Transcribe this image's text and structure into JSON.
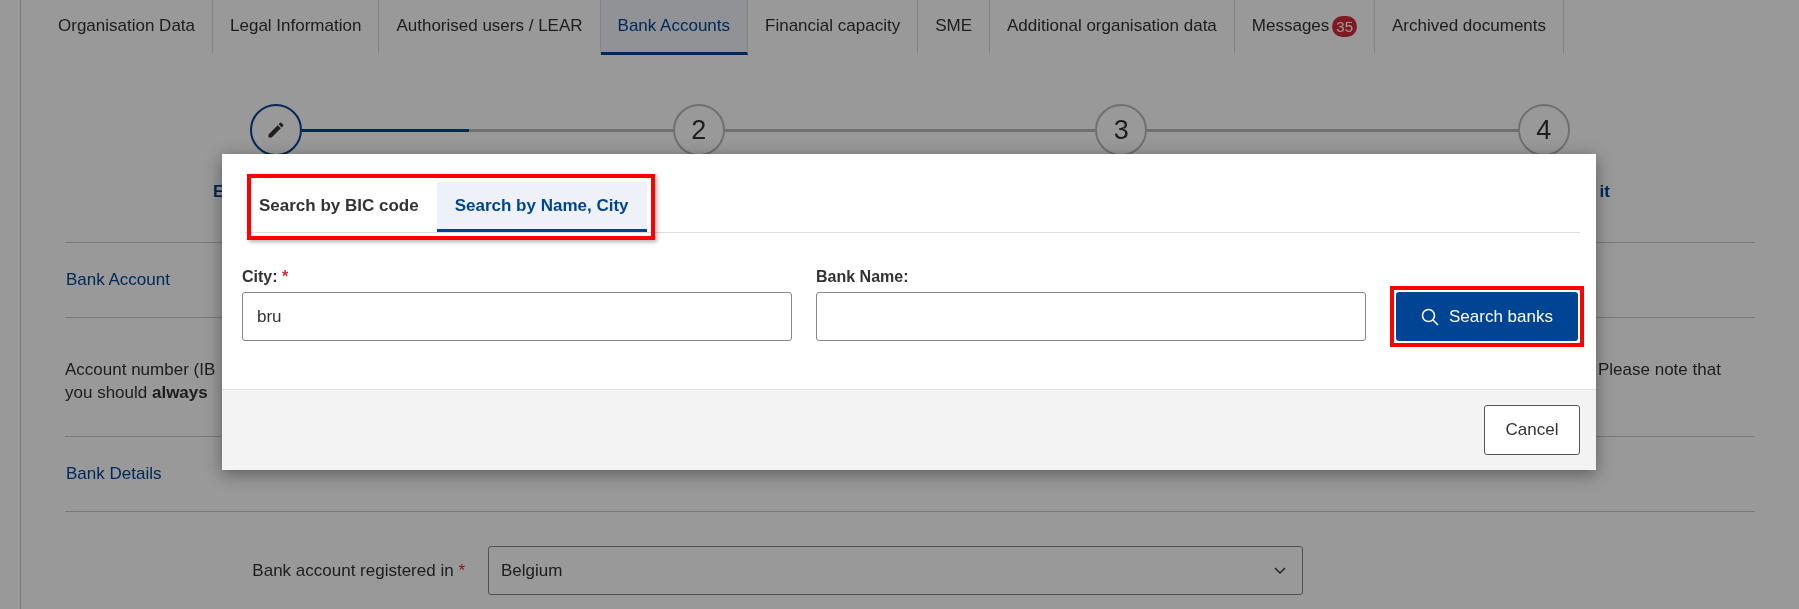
{
  "tabs": [
    {
      "label": "Organisation Data",
      "selected": false
    },
    {
      "label": "Legal Information",
      "selected": false
    },
    {
      "label": "Authorised users / LEAR",
      "selected": false
    },
    {
      "label": "Bank Accounts",
      "selected": true
    },
    {
      "label": "Financial capacity",
      "selected": false
    },
    {
      "label": "SME",
      "selected": false
    },
    {
      "label": "Additional organisation data",
      "selected": false
    },
    {
      "label": "Messages",
      "badge": "35",
      "selected": false
    },
    {
      "label": "Archived documents",
      "selected": false
    }
  ],
  "stepper": [
    {
      "kind": "current",
      "label": "E"
    },
    {
      "kind": "pending",
      "number": "2"
    },
    {
      "kind": "pending",
      "number": "3"
    },
    {
      "kind": "pending",
      "number": "4",
      "label": "it"
    }
  ],
  "sections": [
    {
      "title": "Bank Account",
      "text_left": [
        "Account number (IB",
        "you should **always**"
      ],
      "text_right": "Please note that"
    },
    {
      "title": "Bank Details",
      "field": {
        "label": "Bank account registered in",
        "required_mark": "*",
        "value": "Belgium"
      }
    }
  ],
  "dialog": {
    "tabs": [
      {
        "label": "Search by BIC code",
        "selected": false
      },
      {
        "label": "Search by Name, City",
        "selected": true
      }
    ],
    "tabs_highlighted": true,
    "fields": [
      {
        "label": "City:",
        "required_mark": "*",
        "value": "bru"
      },
      {
        "label": "Bank Name:"
      }
    ],
    "search_button": {
      "label": "Search banks",
      "highlighted": true
    },
    "cancel_button": "Cancel"
  }
}
